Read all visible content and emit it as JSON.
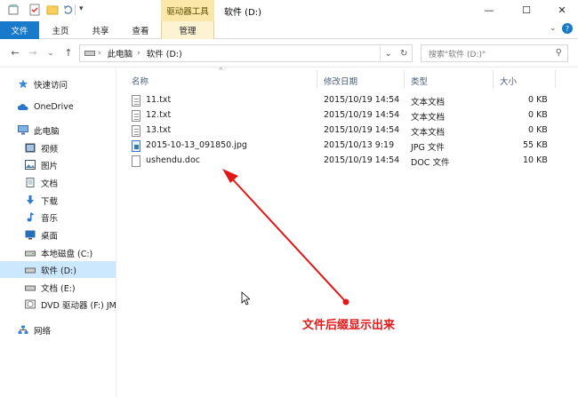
{
  "window": {
    "title": "软件 (D:)",
    "context_group": "驱动器工具",
    "minimize_glyph": "—",
    "maximize_glyph": "☐",
    "close_glyph": "✕"
  },
  "ribbon": {
    "tabs": [
      "文件",
      "主页",
      "共享",
      "查看",
      "管理"
    ]
  },
  "address": {
    "segments": [
      "此电脑",
      "软件 (D:)"
    ],
    "search_placeholder": "搜索\"软件 (D:)\""
  },
  "nav": {
    "items": [
      {
        "label": "快速访问",
        "icon": "star-icon"
      },
      {
        "label": "OneDrive",
        "icon": "cloud-icon"
      },
      {
        "label": "此电脑",
        "icon": "computer-icon"
      },
      {
        "label": "视频",
        "icon": "video-icon"
      },
      {
        "label": "图片",
        "icon": "pictures-icon"
      },
      {
        "label": "文档",
        "icon": "documents-icon"
      },
      {
        "label": "下载",
        "icon": "download-icon"
      },
      {
        "label": "音乐",
        "icon": "music-icon"
      },
      {
        "label": "桌面",
        "icon": "desktop-icon"
      },
      {
        "label": "本地磁盘 (C:)",
        "icon": "drive-icon"
      },
      {
        "label": "软件 (D:)",
        "icon": "drive-icon",
        "selected": true
      },
      {
        "label": "文档 (E:)",
        "icon": "drive-icon"
      },
      {
        "label": "DVD 驱动器 (F:) JM",
        "icon": "dvd-icon"
      },
      {
        "label": "网络",
        "icon": "network-icon"
      }
    ]
  },
  "columns": {
    "name": "名称",
    "modified": "修改日期",
    "type": "类型",
    "size": "大小"
  },
  "files": [
    {
      "name": "11.txt",
      "modified": "2015/10/19 14:54",
      "type": "文本文档",
      "size": "0 KB",
      "kind": "txt"
    },
    {
      "name": "12.txt",
      "modified": "2015/10/19 14:54",
      "type": "文本文档",
      "size": "0 KB",
      "kind": "txt"
    },
    {
      "name": "13.txt",
      "modified": "2015/10/19 14:54",
      "type": "文本文档",
      "size": "0 KB",
      "kind": "txt"
    },
    {
      "name": "2015-10-13_091850.jpg",
      "modified": "2015/10/13 9:19",
      "type": "JPG 文件",
      "size": "55 KB",
      "kind": "jpg"
    },
    {
      "name": "ushendu.doc",
      "modified": "2015/10/19 14:54",
      "type": "DOC 文件",
      "size": "10 KB",
      "kind": "doc"
    }
  ],
  "annotation": {
    "text": "文件后缀显示出来",
    "color": "#e01818"
  },
  "colors": {
    "file_tab": "#1979ca",
    "context_tab": "#fbe8a8",
    "selection": "#cce8ff"
  }
}
